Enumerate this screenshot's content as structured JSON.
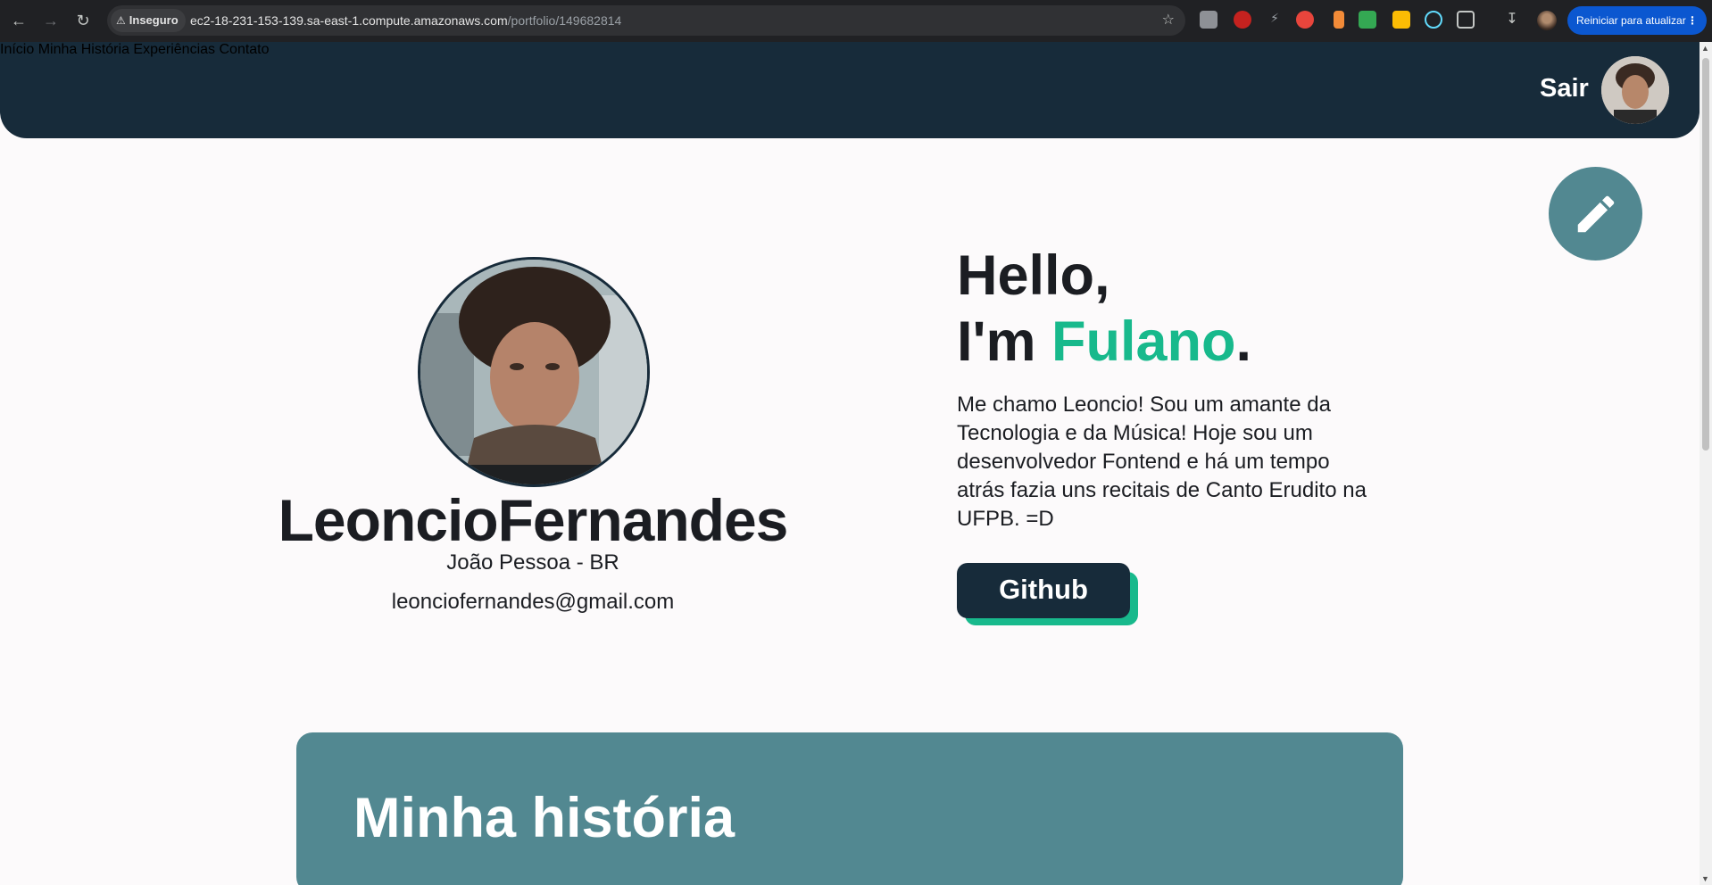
{
  "browser": {
    "security_label": "Inseguro",
    "url_host": "ec2-18-231-153-139.sa-east-1.compute.amazonaws.com",
    "url_path": "/portfolio/149682814",
    "restart_label": "Reiniciar para atualizar"
  },
  "nav": {
    "items": [
      "Início",
      "Minha História",
      "Experiências",
      "Contato"
    ],
    "logout_label": "Sair"
  },
  "profile": {
    "name": "LeoncioFernandes",
    "location": "João Pessoa - BR",
    "email": "leonciofernandes@gmail.com"
  },
  "hero": {
    "greeting": "Hello,",
    "intro_prefix": "I'm ",
    "intro_name": "Fulano",
    "intro_suffix": ".",
    "bio": "Me chamo Leoncio! Sou um amante da Tecnologia e da Música! Hoje sou um desenvolvedor Fontend e há um tempo atrás fazia uns recitais de Canto Erudito na UFPB. =D",
    "github_label": "Github"
  },
  "story": {
    "title": "Minha história"
  },
  "colors": {
    "header_bg": "#172b3a",
    "accent_green": "#18b98c",
    "teal": "#528891"
  }
}
